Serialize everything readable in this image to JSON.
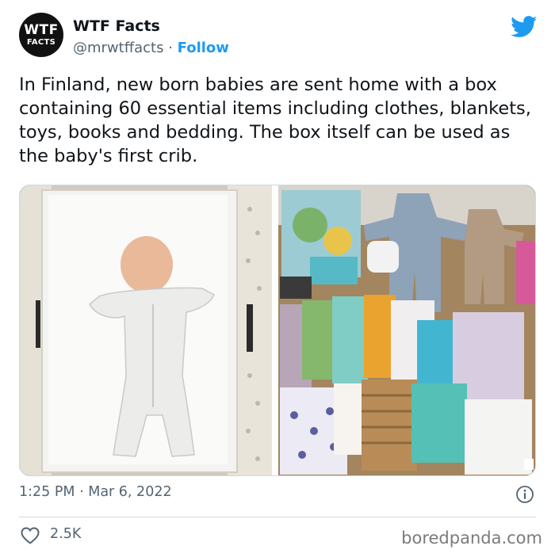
{
  "account": {
    "avatar_line1": "WTF",
    "avatar_line2": "FACTS",
    "name": "WTF Facts",
    "handle": "@mrwtffacts",
    "separator": " · ",
    "follow_label": "Follow"
  },
  "tweet": {
    "text": "In Finland, new born babies are sent home with a box containing 60 essential items including clothes, blankets, toys, books and bedding. The box itself can be used as the baby's first crib.",
    "time": "1:25 PM",
    "date_separator": " · ",
    "date": "Mar 6, 2022"
  },
  "engagement": {
    "likes": "2.5K"
  },
  "footer": {
    "watermark": "boredpanda.com"
  },
  "colors": {
    "accent": "#1d9bf0",
    "text": "#0f1419",
    "muted": "#536471"
  },
  "icons": [
    "twitter-bird-icon",
    "info-icon",
    "heart-icon"
  ]
}
